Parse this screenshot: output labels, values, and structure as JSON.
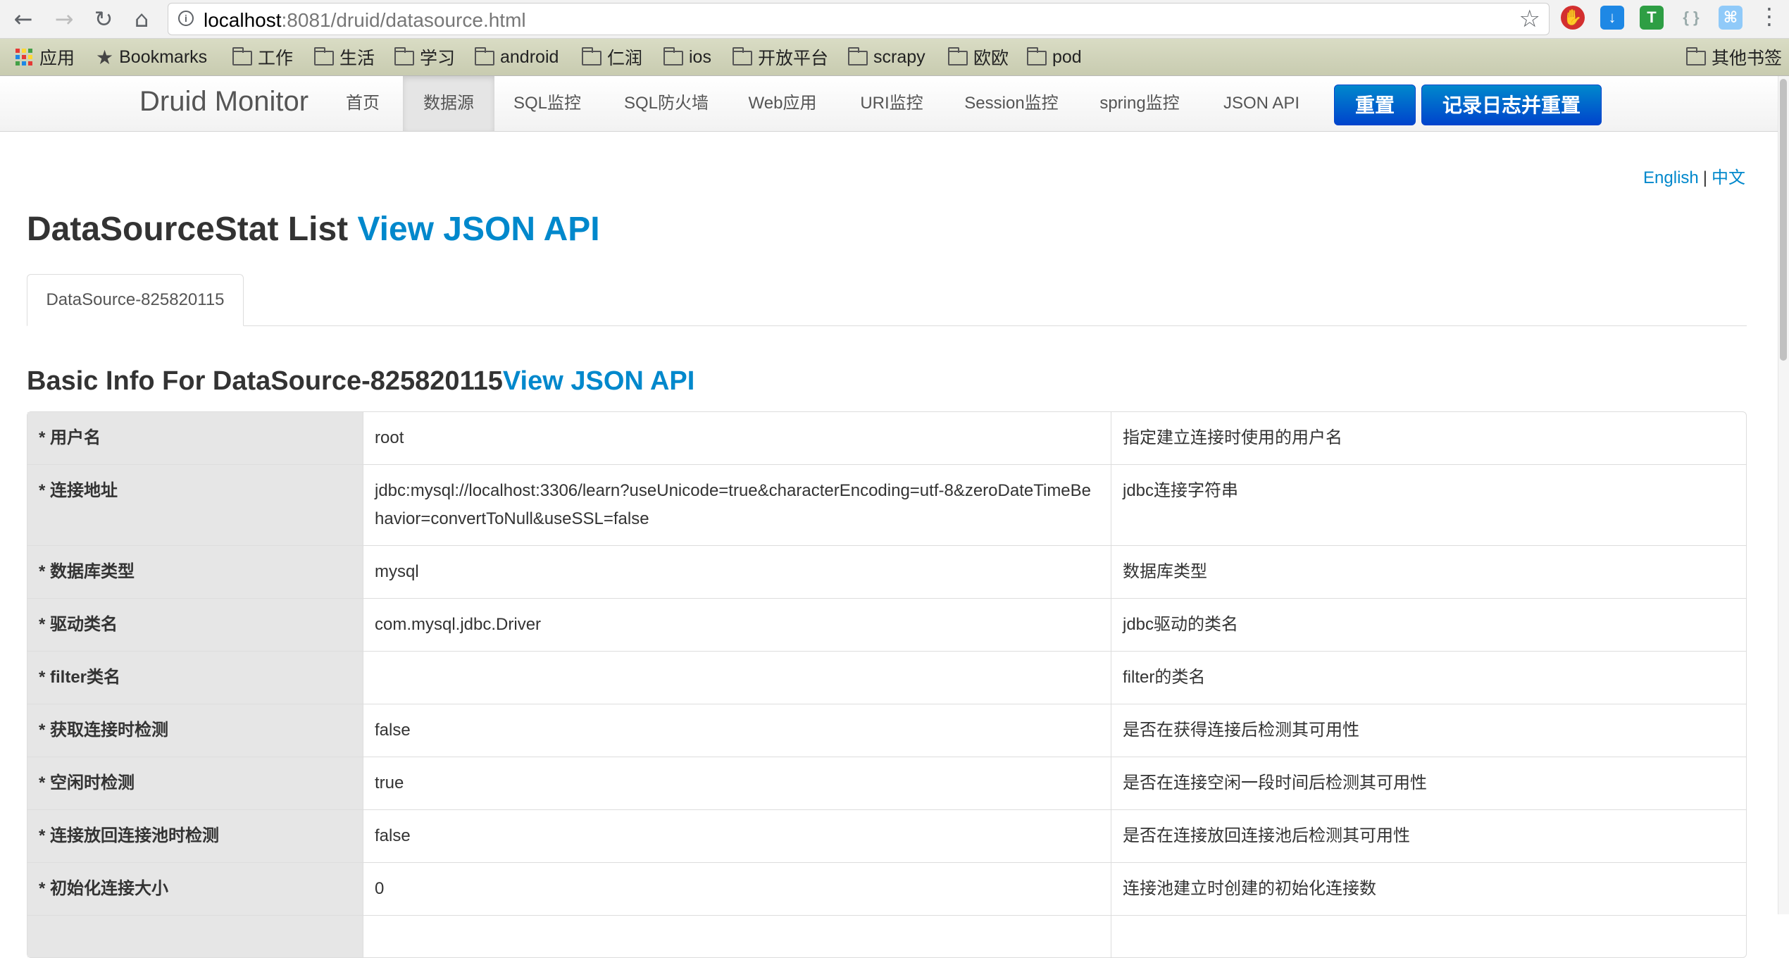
{
  "browser": {
    "back_icon": "arrow-left-icon",
    "forward_icon": "arrow-right-icon",
    "reload_icon": "reload-icon",
    "home_icon": "home-icon",
    "url_host": "localhost",
    "url_rest": ":8081/druid/datasource.html",
    "bookmark_star_icon": "star-icon",
    "menu_icon": "vertical-dots-icon"
  },
  "bookmarks": {
    "items": [
      {
        "label": "应用",
        "icon": "apps-grid-icon"
      },
      {
        "label": "Bookmarks",
        "icon": "star-icon"
      },
      {
        "label": "工作",
        "icon": "folder-icon"
      },
      {
        "label": "生活",
        "icon": "folder-icon"
      },
      {
        "label": "学习",
        "icon": "folder-icon"
      },
      {
        "label": "android",
        "icon": "folder-icon"
      },
      {
        "label": "仁润",
        "icon": "folder-icon"
      },
      {
        "label": "ios",
        "icon": "folder-icon"
      },
      {
        "label": "开放平台",
        "icon": "folder-icon"
      },
      {
        "label": "scrapy",
        "icon": "folder-icon"
      },
      {
        "label": "欧欧",
        "icon": "folder-icon"
      },
      {
        "label": "pod",
        "icon": "folder-icon"
      }
    ],
    "other": "其他书签"
  },
  "nav": {
    "brand": "Druid Monitor",
    "items": [
      "首页",
      "数据源",
      "SQL监控",
      "SQL防火墙",
      "Web应用",
      "URI监控",
      "Session监控",
      "spring监控",
      "JSON API"
    ],
    "active": "数据源",
    "reset_button": "重置",
    "log_reset_button": "记录日志并重置"
  },
  "lang": {
    "english": "English",
    "separator": "|",
    "chinese": "中文"
  },
  "page": {
    "title": "DataSourceStat List ",
    "title_link": "View JSON API",
    "tab": "DataSource-825820115",
    "section_title": "Basic Info For DataSource-825820115",
    "section_link": "View JSON API"
  },
  "table": {
    "rows": [
      {
        "name": "* 用户名",
        "value": "root",
        "desc": "指定建立连接时使用的用户名"
      },
      {
        "name": "* 连接地址",
        "value": "jdbc:mysql://localhost:3306/learn?useUnicode=true&characterEncoding=utf-8&zeroDateTimeBehavior=convertToNull&useSSL=false",
        "desc": "jdbc连接字符串"
      },
      {
        "name": "* 数据库类型",
        "value": "mysql",
        "desc": "数据库类型"
      },
      {
        "name": "* 驱动类名",
        "value": "com.mysql.jdbc.Driver",
        "desc": "jdbc驱动的类名"
      },
      {
        "name": "* filter类名",
        "value": "",
        "desc": "filter的类名"
      },
      {
        "name": "* 获取连接时检测",
        "value": "false",
        "desc": "是否在获得连接后检测其可用性"
      },
      {
        "name": "* 空闲时检测",
        "value": "true",
        "desc": "是否在连接空闲一段时间后检测其可用性"
      },
      {
        "name": "* 连接放回连接池时检测",
        "value": "false",
        "desc": "是否在连接放回连接池后检测其可用性"
      },
      {
        "name": "* 初始化连接大小",
        "value": "0",
        "desc": "连接池建立时创建的初始化连接数"
      }
    ]
  }
}
